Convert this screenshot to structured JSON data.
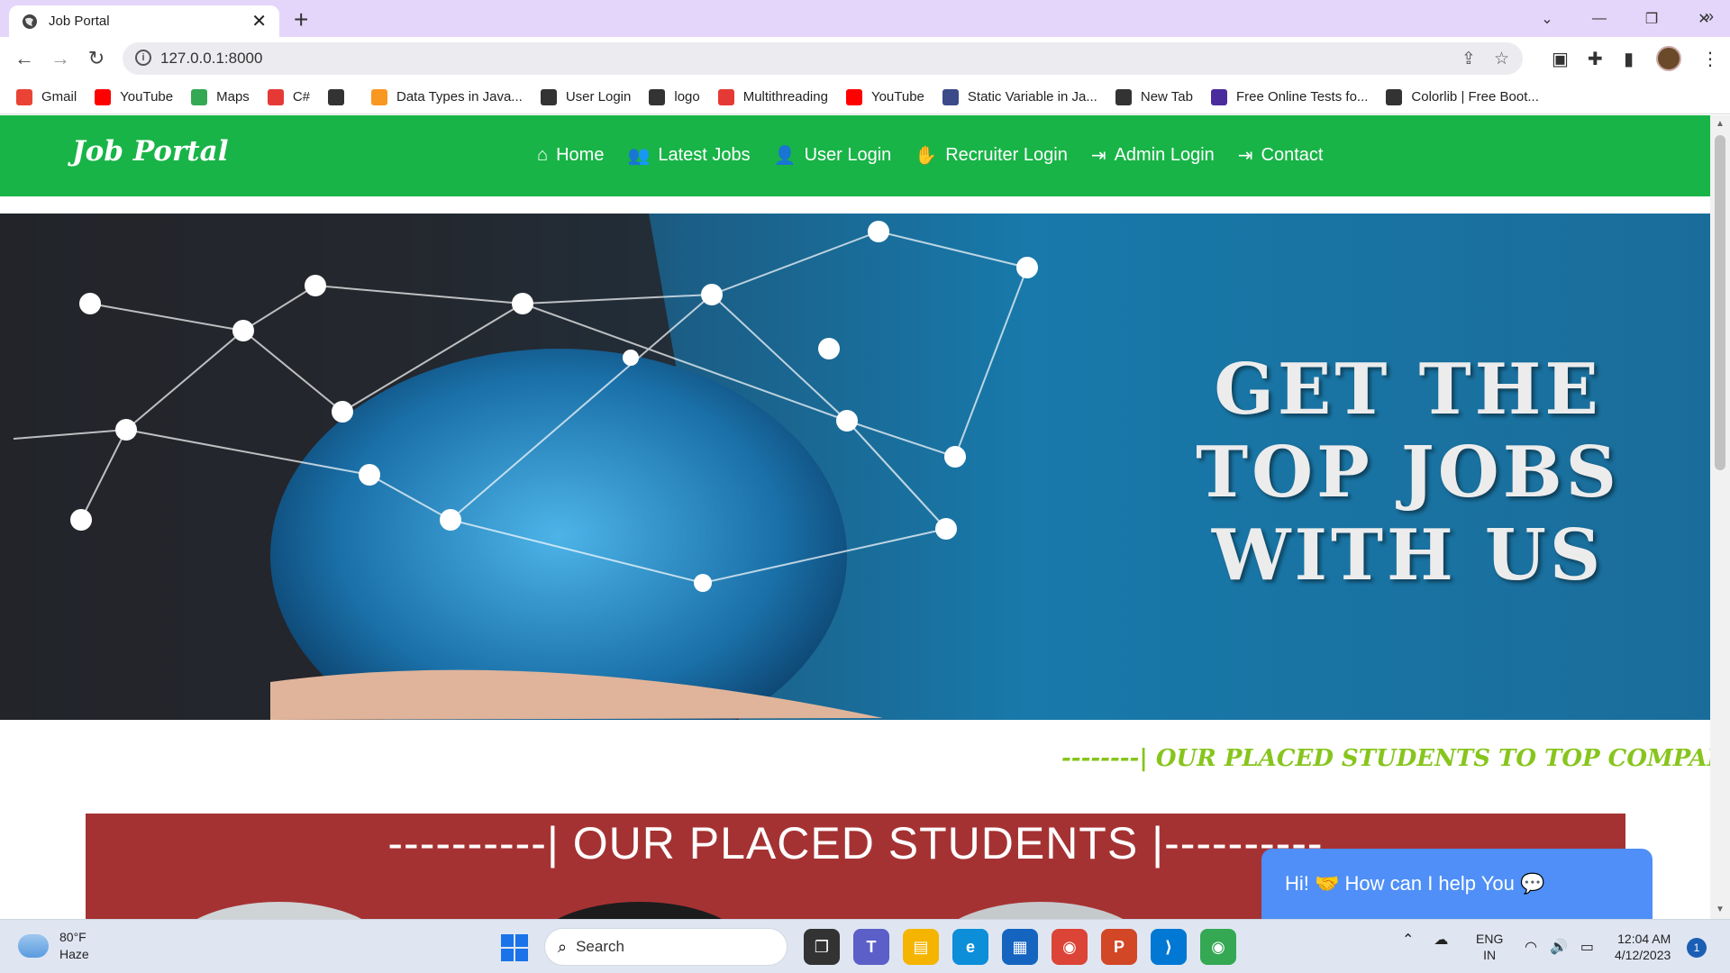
{
  "browser": {
    "tab_title": "Job Portal",
    "url": "127.0.0.1:8000",
    "bookmarks": [
      {
        "label": "Gmail",
        "icon": "gmail-icon",
        "color": "#ea4335"
      },
      {
        "label": "YouTube",
        "icon": "youtube-icon",
        "color": "#ff0000"
      },
      {
        "label": "Maps",
        "icon": "maps-icon",
        "color": "#34a853"
      },
      {
        "label": "C#",
        "icon": "vivaldi-icon",
        "color": "#e53935"
      },
      {
        "label": "",
        "icon": "globe-icon",
        "color": "#333333"
      },
      {
        "label": "Data Types in Java...",
        "icon": "java-icon",
        "color": "#f89820"
      },
      {
        "label": "User Login",
        "icon": "globe-icon",
        "color": "#333333"
      },
      {
        "label": "logo",
        "icon": "globe-icon",
        "color": "#333333"
      },
      {
        "label": "Multithreading",
        "icon": "vivaldi-icon",
        "color": "#e53935"
      },
      {
        "label": "YouTube",
        "icon": "youtube-icon",
        "color": "#ff0000"
      },
      {
        "label": "Static Variable in Ja...",
        "icon": "site-icon",
        "color": "#3c4a8a"
      },
      {
        "label": "New Tab",
        "icon": "globe-icon",
        "color": "#333333"
      },
      {
        "label": "Free Online Tests fo...",
        "icon": "st-icon",
        "color": "#4b2c9c"
      },
      {
        "label": "Colorlib | Free Boot...",
        "icon": "globe-icon",
        "color": "#333333"
      }
    ]
  },
  "page": {
    "brand": "Job Portal",
    "nav": [
      {
        "label": "Home",
        "icon": "home-icon",
        "glyph": "⌂"
      },
      {
        "label": "Latest Jobs",
        "icon": "users-icon",
        "glyph": "👥"
      },
      {
        "label": "User Login",
        "icon": "user-plus-icon",
        "glyph": "👤"
      },
      {
        "label": "Recruiter Login",
        "icon": "hand-icon",
        "glyph": "✋"
      },
      {
        "label": "Admin Login",
        "icon": "sign-in-icon",
        "glyph": "⇥"
      },
      {
        "label": "Contact",
        "icon": "sign-in-icon",
        "glyph": "⇥"
      }
    ],
    "hero_lines": [
      "GET THE",
      "TOP JOBS",
      "WITH US"
    ],
    "marquee": "--------| OUR PLACED STUDENTS TO TOP COMPANY IN",
    "placed_heading": "----------| OUR PLACED STUDENTS |----------",
    "chat_text": "Hi! 🤝 How can I help You 💬"
  },
  "taskbar": {
    "weather_temp": "80°F",
    "weather_desc": "Haze",
    "search_label": "Search",
    "lang_1": "ENG",
    "lang_2": "IN",
    "time": "12:04 AM",
    "date": "4/12/2023",
    "notifications": "1",
    "apps": [
      {
        "name": "task-view-icon",
        "color": "#333333",
        "glyph": "❐"
      },
      {
        "name": "teams-icon",
        "color": "#5b5fc7",
        "glyph": "T"
      },
      {
        "name": "file-explorer-icon",
        "color": "#f4b400",
        "glyph": "▤"
      },
      {
        "name": "edge-icon",
        "color": "#0c8ed9",
        "glyph": "e"
      },
      {
        "name": "store-icon",
        "color": "#1565c0",
        "glyph": "▦"
      },
      {
        "name": "chrome-icon",
        "color": "#db4437",
        "glyph": "◉"
      },
      {
        "name": "powerpoint-icon",
        "color": "#d24726",
        "glyph": "P"
      },
      {
        "name": "vscode-icon",
        "color": "#0078d4",
        "glyph": "⟩"
      },
      {
        "name": "chrome-profile-icon",
        "color": "#34a853",
        "glyph": "◉"
      }
    ]
  }
}
